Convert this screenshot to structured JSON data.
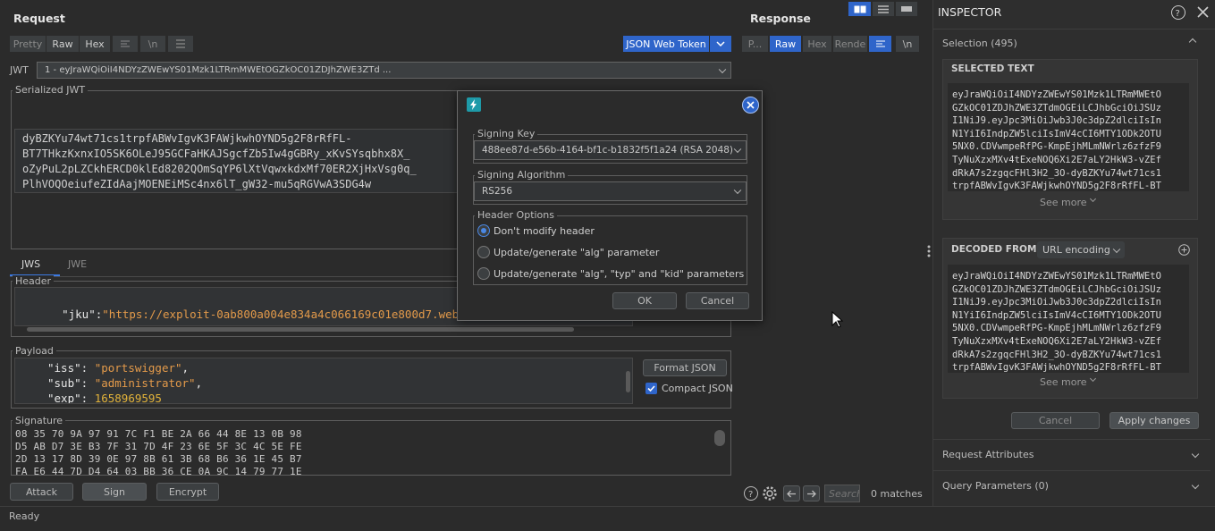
{
  "request": {
    "title": "Request",
    "tabs": [
      "Pretty",
      "Raw",
      "Hex"
    ],
    "extension_tab": "JSON Web Token",
    "jwt_label": "JWT",
    "jwt_selected": "1 - eyJraWQiOiI4NDYzZWEwYS01Mzk1LTRmMWEtOGZkOC01ZDJhZWE3ZTd ...",
    "serialized_label": "Serialized JWT",
    "serialized_lines": [
      "dyBZKYu74wt71cs1trpfABWvIgvK3FAWjkwhOYND5g2F8rRfFL-",
      "BT7THkzKxnxIO5SK6OLeJ95GCFaHKAJSgcfZb5Iw4gGBRy_xKvSYsqbhx8X_",
      "oZyPuL2pLZCkhERCD0klEd8202QOmSqYP6lXtVqwxkdxMf70ER2XjHxVsg0q_",
      "PlhVOQOeiufeZIdAajMOENEiMSc4nx6lT_gW32-mu5qRGVwA3SDG4w"
    ],
    "jws_tab": "JWS",
    "jwe_tab": "JWE",
    "header_label": "Header",
    "header_key": "\"jku\"",
    "header_value": "\"https://exploit-0ab800a004e834a4c066169c01e800d7.web",
    "payload_label": "Payload",
    "payload_lines": [
      {
        "key": "\"iss\"",
        "value": "\"portswigger\"",
        "tail": ","
      },
      {
        "key": "\"sub\"",
        "value": "\"administrator\"",
        "tail": ","
      },
      {
        "key": "\"exp\"",
        "value": "1658969595",
        "tail": ""
      }
    ],
    "format_json": "Format JSON",
    "compact_json": "Compact JSON",
    "signature_label": "Signature",
    "signature_lines": [
      "08 35 70 9A 97 91 7C F1 BE 2A 66 44 8E 13 0B 98",
      "D5 AB D7 3E B3 7F 31 7D 4F 23 6E 5F 3C 4C 5E FE",
      "2D 13 17 8D 39 0E 97 8B 61 3B 68 B6 36 1E 45 B7",
      "FA E6 44 7D D4 64 03 BB 36 CE 0A 9C 14 79 77 1E"
    ],
    "attack": "Attack",
    "sign": "Sign",
    "encrypt": "Encrypt"
  },
  "response": {
    "title": "Response",
    "tabs": [
      "P...",
      "Raw",
      "Hex",
      "Rende"
    ],
    "search_placeholder": "Search...",
    "matches": "0 matches"
  },
  "status": "Ready",
  "dialog": {
    "signing_key_label": "Signing Key",
    "signing_key_value": "488ee87d-e56b-4164-bf1c-b1832f5f1a24 (RSA 2048)",
    "signing_alg_label": "Signing Algorithm",
    "signing_alg_value": "RS256",
    "header_options_label": "Header Options",
    "options": [
      "Don't modify header",
      "Update/generate \"alg\" parameter",
      "Update/generate \"alg\", \"typ\" and \"kid\" parameters"
    ],
    "ok": "OK",
    "cancel": "Cancel"
  },
  "inspector": {
    "title": "INSPECTOR",
    "selection": "Selection (495)",
    "selected_text_label": "SELECTED TEXT",
    "selected_text": [
      "eyJraWQiOiI4NDYzZWEwYS01Mzk1LTRmMWEtO",
      "GZkOC01ZDJhZWE3ZTdmOGEiLCJhbGciOiJSUz",
      "I1NiJ9.eyJpc3MiOiJwb3J0c3dpZ2dlciIsIn",
      "N1YiI6IndpZW5lciIsImV4cCI6MTY1ODk2OTU",
      "5NX0.CDVwmpeRfPG-KmpEjhMLmNWrlz6zfzF9",
      "TyNuXzxMXv4tExeNOQ6Xi2E7aLY2HkW3-vZEf",
      "dRkA7s2zgqcFHl3H2_3O-dyBZKYu74wt71cs1",
      "trpfABWvIgvK3FAWjkwhOYND5g2F8rRfFL-BT"
    ],
    "see_more": "See more",
    "decoded_from_label": "DECODED FROM:",
    "decoded_from_value": "URL encoding",
    "decoded_text": [
      "eyJraWQiOiI4NDYzZWEwYS01Mzk1LTRmMWEtO",
      "GZkOC01ZDJhZWE3ZTdmOGEiLCJhbGciOiJSUz",
      "I1NiJ9.eyJpc3MiOiJwb3J0c3dpZ2dlciIsIn",
      "N1YiI6IndpZW5lciIsImV4cCI6MTY1ODk2OTU",
      "5NX0.CDVwmpeRfPG-KmpEjhMLmNWrlz6zfzF9",
      "TyNuXzxMXv4tExeNOQ6Xi2E7aLY2HkW3-vZEf",
      "dRkA7s2zgqcFHl3H2_3O-dyBZKYu74wt71cs1",
      "trpfABWvIgvK3FAWjkwhOYND5g2F8rRfFL-BT"
    ],
    "cancel": "Cancel",
    "apply": "Apply changes",
    "sections": [
      "Request Attributes",
      "Query Parameters (0)"
    ]
  }
}
